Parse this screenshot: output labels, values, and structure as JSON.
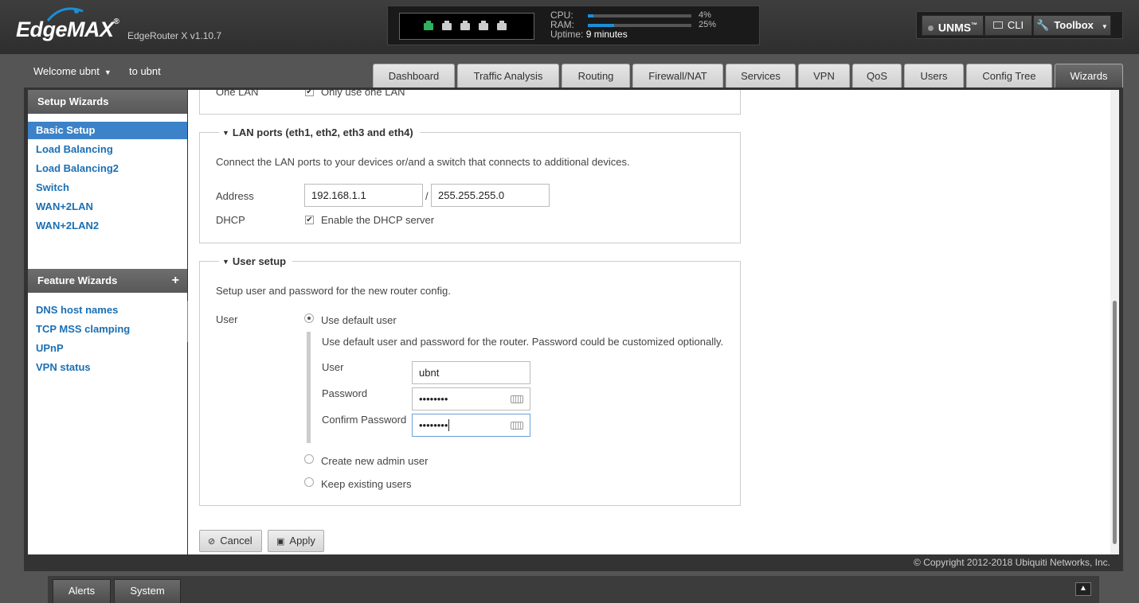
{
  "header": {
    "logo_text": "EdgeMAX",
    "logo_tm": "®",
    "model": "EdgeRouter X v1.10.7",
    "ports": {
      "count": 5,
      "active_index": 0,
      "active_color": "#2db35d"
    },
    "cpu": {
      "label": "CPU:",
      "value": "4%",
      "fraction": 0.04
    },
    "ram": {
      "label": "RAM:",
      "value": "25%",
      "fraction": 0.25
    },
    "uptime": {
      "label": "Uptime:",
      "value": "9 minutes"
    },
    "buttons": {
      "unms": "UNMS",
      "unms_tm": "™",
      "cli": "CLI",
      "toolbox": "Toolbox"
    }
  },
  "nav": {
    "welcome": "Welcome ubnt",
    "to_user": "to ubnt",
    "tabs": [
      "Dashboard",
      "Traffic Analysis",
      "Routing",
      "Firewall/NAT",
      "Services",
      "VPN",
      "QoS",
      "Users",
      "Config Tree",
      "Wizards"
    ],
    "active_tab": "Wizards"
  },
  "sidebar": {
    "setup_heading": "Setup Wizards",
    "setup_items": [
      "Basic Setup",
      "Load Balancing",
      "Load Balancing2",
      "Switch",
      "WAN+2LAN",
      "WAN+2LAN2"
    ],
    "active_item": "Basic Setup",
    "feature_heading": "Feature Wizards",
    "feature_plus": "+",
    "feature_items": [
      "DNS host names",
      "TCP MSS clamping",
      "UPnP",
      "VPN status"
    ]
  },
  "form": {
    "one_lan": {
      "label": "One LAN",
      "checkbox_label": "Only use one LAN",
      "checked": true
    },
    "lan_ports": {
      "legend": "LAN ports (eth1, eth2, eth3 and eth4)",
      "description": "Connect the LAN ports to your devices or/and a switch that connects to additional devices.",
      "address_label": "Address",
      "address_value": "192.168.1.1",
      "separator": "/",
      "netmask_value": "255.255.255.0",
      "dhcp_label": "DHCP",
      "dhcp_checkbox_label": "Enable the DHCP server",
      "dhcp_checked": true
    },
    "user_setup": {
      "legend": "User setup",
      "description": "Setup user and password for the new router config.",
      "user_label": "User",
      "options": [
        "Use default user",
        "Create new admin user",
        "Keep existing users"
      ],
      "selected": "Use default user",
      "default_description": "Use default user and password for the router. Password could be customized optionally.",
      "username_label": "User",
      "username_value": "ubnt",
      "password_label": "Password",
      "password_value": "••••••••",
      "confirm_label": "Confirm Password",
      "confirm_value": "••••••••"
    },
    "buttons": {
      "cancel": "Cancel",
      "apply": "Apply"
    }
  },
  "footer": {
    "copyright": "© Copyright 2012-2018 Ubiquiti Networks, Inc.",
    "bottom_tabs": [
      "Alerts",
      "System"
    ],
    "expand_icon": "chevron-up-icon"
  },
  "colors": {
    "accent": "#3c82c8",
    "link": "#1a6fb4",
    "meter": "#1a8fd8"
  }
}
